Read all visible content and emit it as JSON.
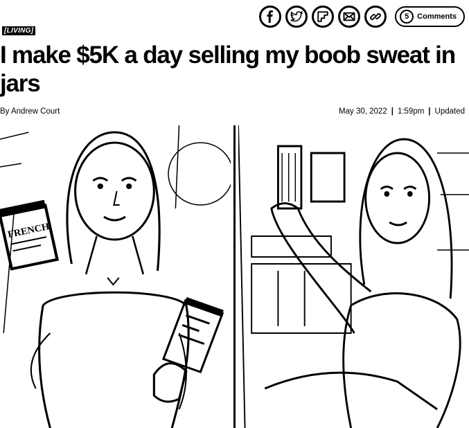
{
  "share": {
    "buttons": [
      {
        "name": "facebook",
        "icon": "facebook-icon"
      },
      {
        "name": "twitter",
        "icon": "twitter-icon"
      },
      {
        "name": "flipboard",
        "icon": "flipboard-icon"
      },
      {
        "name": "email",
        "icon": "email-icon"
      },
      {
        "name": "copy-link",
        "icon": "link-icon"
      }
    ],
    "comments_label": "Comments"
  },
  "article": {
    "section": "[LIVING]",
    "headline": "I make $5K a day selling my boob sweat in jars",
    "byline": "By Andrew Court",
    "date": "May 30, 2022",
    "time": "1:59pm",
    "updated_label": "Updated"
  },
  "hero": {
    "jar_label": "FRENCH",
    "panels": [
      "left-photo",
      "right-photo"
    ]
  }
}
